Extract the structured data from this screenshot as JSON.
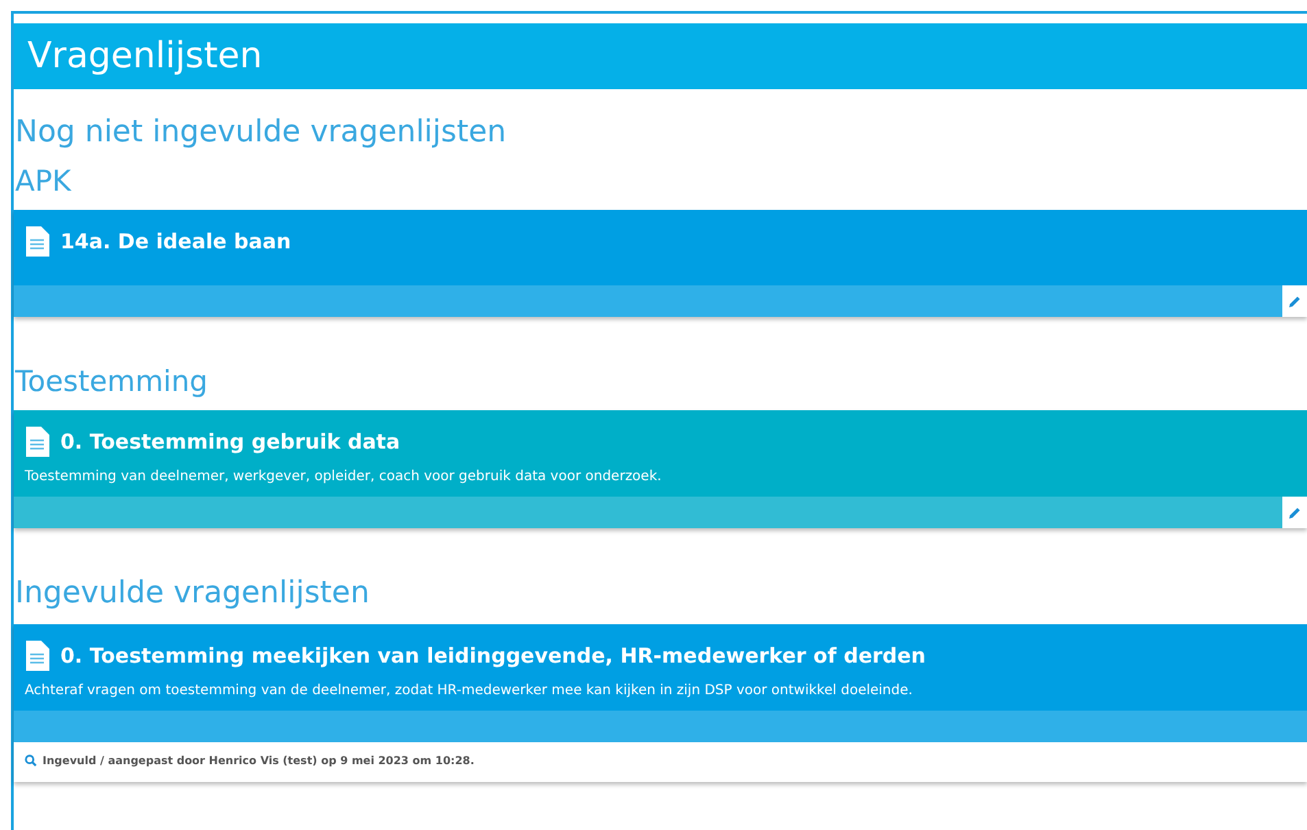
{
  "header": {
    "title": "Vragenlijsten"
  },
  "sections": [
    {
      "heading": "Nog niet ingevulde vragenlijsten",
      "groups": [
        {
          "heading": "APK",
          "cards": [
            {
              "kind": "blue",
              "title": "14a. De ideale baan",
              "editable": true
            }
          ]
        },
        {
          "heading": "Toestemming",
          "cards": [
            {
              "kind": "teal",
              "title": "0. Toestemming gebruik data",
              "description": "Toestemming van deelnemer, werkgever, opleider, coach voor gebruik data voor onderzoek.",
              "editable": true
            }
          ]
        }
      ]
    },
    {
      "heading": "Ingevulde vragenlijsten",
      "groups": [
        {
          "cards": [
            {
              "kind": "blue",
              "title": "0. Toestemming meekijken van leidinggevende, HR-medewerker of derden",
              "description": "Achteraf vragen om toestemming van de deelnemer, zodat HR-medewerker mee kan kijken in zijn DSP voor ontwikkel doeleinde.",
              "editable": false,
              "note": "Ingevuld / aangepast door Henrico Vis (test) op 9 mei 2023 om 10:28."
            }
          ]
        }
      ]
    }
  ]
}
